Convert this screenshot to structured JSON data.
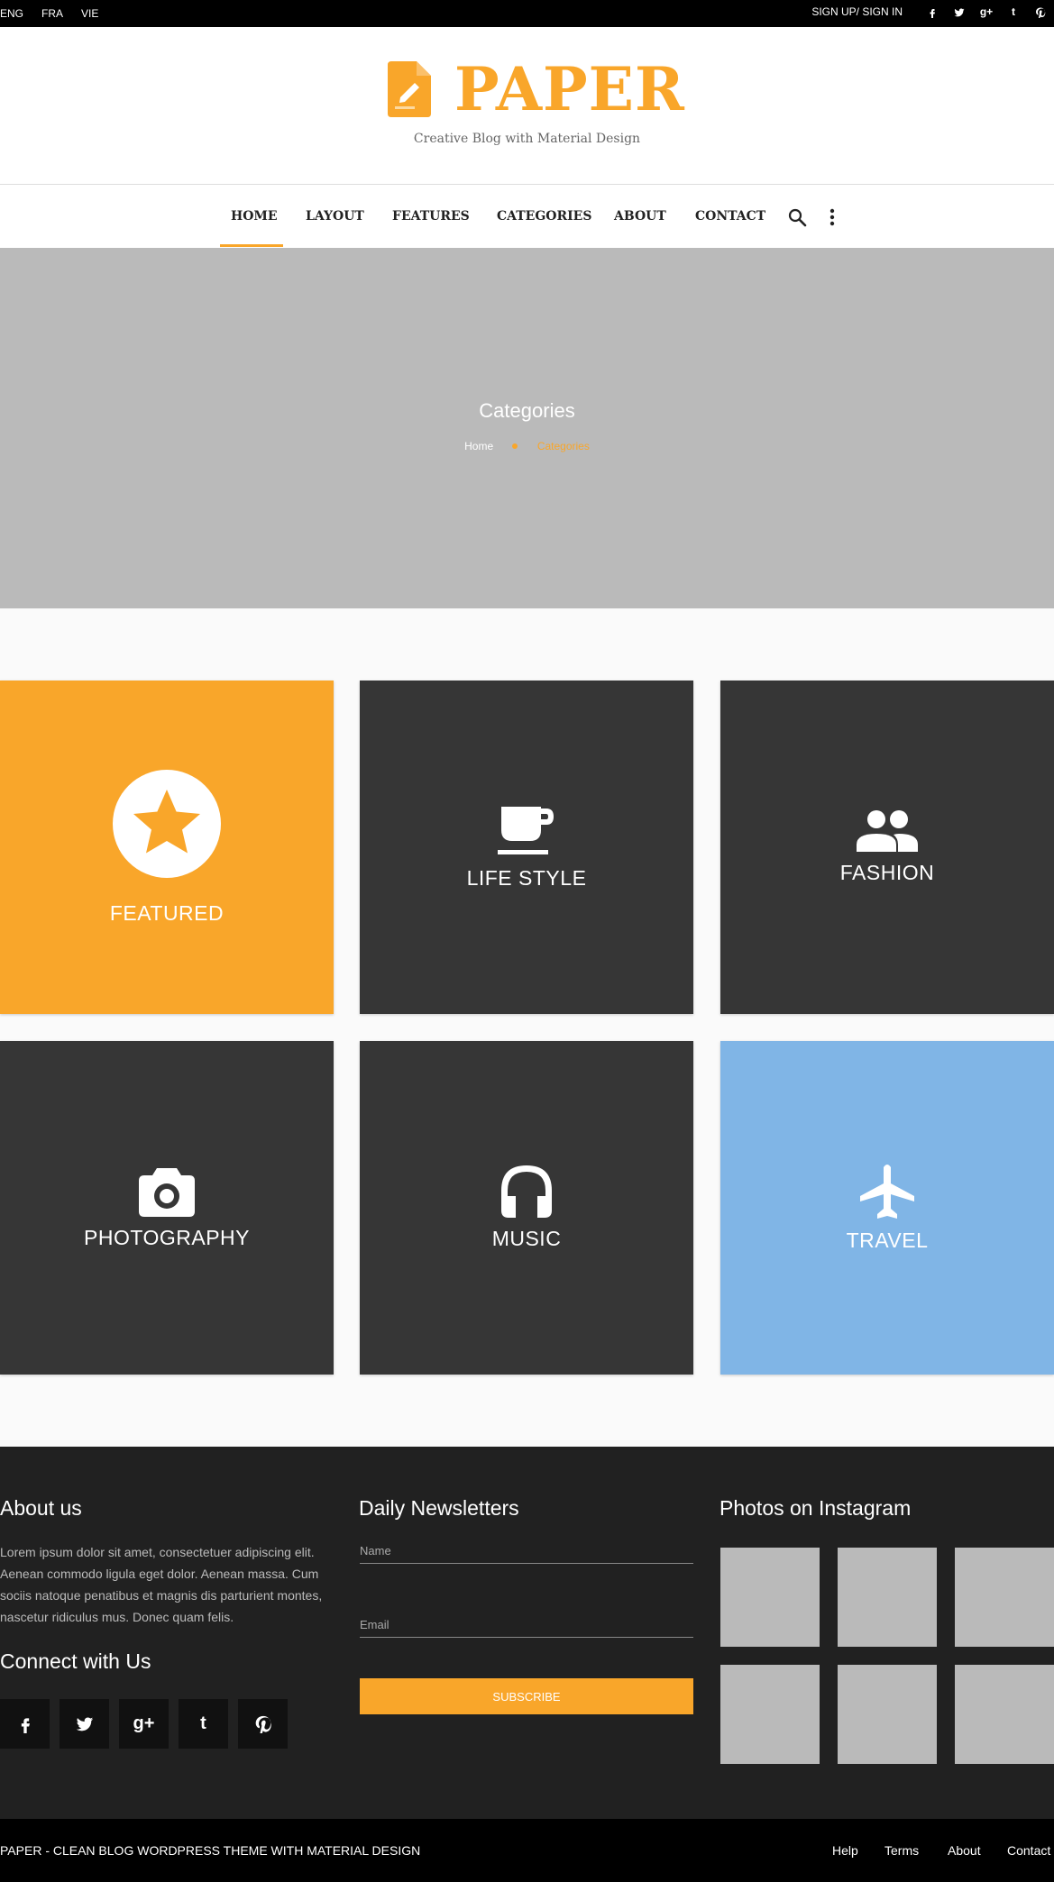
{
  "topbar": {
    "languages": [
      "ENG",
      "FRA",
      "VIE"
    ],
    "signin": "SIGN UP/ SIGN IN",
    "social": {
      "twitter": "t",
      "gplus": "g+",
      "tumblr": "t"
    }
  },
  "header": {
    "logo_text": "PAPER",
    "tagline": "Creative Blog with Material Design",
    "brand_color": "#f9a62a"
  },
  "nav": {
    "items": [
      "HOME",
      "LAYOUT",
      "FEATURES",
      "CATEGORIES",
      "ABOUT",
      "CONTACT"
    ],
    "active": "HOME"
  },
  "hero": {
    "title": "Categories",
    "breadcrumb": [
      "Home",
      "Categories"
    ]
  },
  "categories": [
    {
      "label": "FEATURED",
      "icon": "star-icon",
      "color": "#f9a62a"
    },
    {
      "label": "LIFE STYLE",
      "icon": "coffee-cup-icon",
      "color": "#363636"
    },
    {
      "label": "FASHION",
      "icon": "people-icon",
      "color": "#363636"
    },
    {
      "label": "PHOTOGRAPHY",
      "icon": "camera-icon",
      "color": "#363636"
    },
    {
      "label": "MUSIC",
      "icon": "headphones-icon",
      "color": "#363636"
    },
    {
      "label": "TRAVEL",
      "icon": "airplane-icon",
      "color": "#80b5e6"
    }
  ],
  "footer": {
    "about_title": "About us",
    "about_text": "Lorem ipsum dolor sit amet, consectetuer adipiscing elit. Aenean commodo ligula eget dolor. Aenean massa. Cum sociis natoque penatibus et magnis dis parturient montes, nascetur ridiculus mus. Donec quam felis.",
    "connect_title": "Connect with Us",
    "connect_social": {
      "facebook": "f",
      "gplus": "g+",
      "tumblr": "t"
    },
    "newsletter_title": "Daily Newsletters",
    "name_placeholder": "Name",
    "email_placeholder": "Email",
    "subscribe_label": "SUBSCRIBE",
    "instagram_title": "Photos on Instagram"
  },
  "bottom": {
    "copyright": "PAPER - CLEAN BLOG WORDPRESS THEME WITH MATERIAL DESIGN",
    "links": [
      "Help",
      "Terms",
      "About",
      "Contact"
    ]
  }
}
